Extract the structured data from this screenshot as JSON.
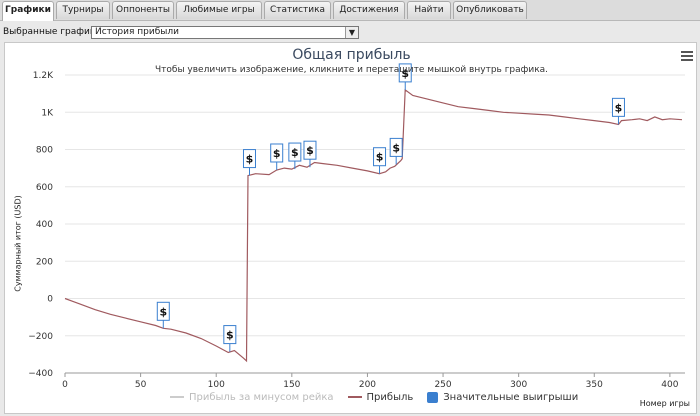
{
  "tabs": [
    {
      "label": "Графики",
      "active": true
    },
    {
      "label": "Турниры"
    },
    {
      "label": "Оппоненты"
    },
    {
      "label": "Любимые игры"
    },
    {
      "label": "Статистика"
    },
    {
      "label": "Достижения"
    },
    {
      "label": "Найти"
    },
    {
      "label": "Опубликовать"
    }
  ],
  "selector": {
    "label": "Выбранные графики:",
    "value": "История прибыли"
  },
  "chart_data": {
    "type": "line",
    "title": "Общая прибыль",
    "subtitle": "Чтобы увеличить изображение, кликните и перетащите мышкой внутрь графика.",
    "xlabel": "Номер игры",
    "ylabel": "Суммарный итог (USD)",
    "xlim": [
      0,
      410
    ],
    "ylim": [
      -400,
      1200
    ],
    "x_ticks": [
      0,
      50,
      100,
      150,
      200,
      250,
      300,
      350,
      400
    ],
    "y_ticks": [
      -400,
      -200,
      0,
      200,
      400,
      600,
      800,
      1000,
      1200
    ],
    "y_tick_labels": [
      "−400",
      "−200",
      "0",
      "200",
      "400",
      "600",
      "800",
      "1K",
      "1.2K"
    ],
    "series": [
      {
        "name": "Прибыль за минусом рейка",
        "color": "#cccccc",
        "points": []
      },
      {
        "name": "Прибыль",
        "color": "#a05a5f",
        "points": [
          [
            0,
            0
          ],
          [
            5,
            -15
          ],
          [
            10,
            -30
          ],
          [
            20,
            -60
          ],
          [
            30,
            -85
          ],
          [
            40,
            -105
          ],
          [
            50,
            -125
          ],
          [
            60,
            -145
          ],
          [
            65,
            -160
          ],
          [
            70,
            -165
          ],
          [
            80,
            -185
          ],
          [
            90,
            -215
          ],
          [
            100,
            -255
          ],
          [
            108,
            -290
          ],
          [
            112,
            -280
          ],
          [
            118,
            -320
          ],
          [
            120,
            -335
          ],
          [
            121,
            660
          ],
          [
            126,
            670
          ],
          [
            135,
            665
          ],
          [
            140,
            690
          ],
          [
            145,
            700
          ],
          [
            150,
            695
          ],
          [
            155,
            715
          ],
          [
            160,
            705
          ],
          [
            165,
            730
          ],
          [
            170,
            725
          ],
          [
            180,
            715
          ],
          [
            190,
            700
          ],
          [
            200,
            685
          ],
          [
            208,
            670
          ],
          [
            212,
            680
          ],
          [
            215,
            700
          ],
          [
            218,
            710
          ],
          [
            222,
            740
          ],
          [
            223,
            750
          ],
          [
            225,
            1120
          ],
          [
            230,
            1090
          ],
          [
            240,
            1070
          ],
          [
            250,
            1050
          ],
          [
            260,
            1030
          ],
          [
            270,
            1020
          ],
          [
            280,
            1010
          ],
          [
            290,
            1000
          ],
          [
            300,
            995
          ],
          [
            310,
            990
          ],
          [
            320,
            985
          ],
          [
            330,
            975
          ],
          [
            340,
            965
          ],
          [
            350,
            955
          ],
          [
            360,
            945
          ],
          [
            366,
            935
          ],
          [
            368,
            955
          ],
          [
            375,
            960
          ],
          [
            380,
            965
          ],
          [
            385,
            955
          ],
          [
            390,
            975
          ],
          [
            395,
            960
          ],
          [
            400,
            965
          ],
          [
            408,
            960
          ]
        ]
      }
    ],
    "markers_legend": {
      "name": "Значительные выигрыши",
      "color": "#3a7fcf",
      "glyph": "$"
    },
    "markers": [
      [
        65,
        -160
      ],
      [
        109,
        -285
      ],
      [
        122,
        660
      ],
      [
        140,
        690
      ],
      [
        152,
        695
      ],
      [
        162,
        705
      ],
      [
        208,
        670
      ],
      [
        219,
        720
      ],
      [
        225,
        1120
      ],
      [
        366,
        935
      ]
    ]
  }
}
